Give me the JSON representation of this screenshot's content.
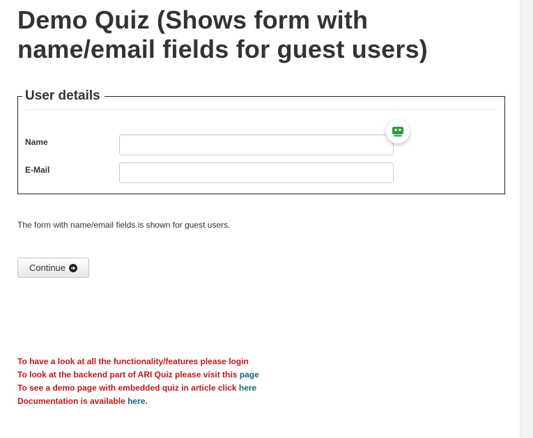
{
  "quiz": {
    "title": "Demo Quiz (Shows form with name/email fields for guest users)"
  },
  "user_details": {
    "legend": "User details",
    "name_label": "Name",
    "name_value": "",
    "email_label": "E-Mail",
    "email_value": ""
  },
  "note": "The form with name/email fields is shown for guest users.",
  "continue_button": {
    "label": "Continue",
    "icon": "arrow-circle-right-icon"
  },
  "info_links": {
    "line1": "To have a look at all the functionality/features please login",
    "line2_text": "To look at the backend part of ARI Quiz please visit this",
    "line2_link": "page",
    "line3_text": "To see a demo page with embedded quiz in article click",
    "line3_link": "here",
    "line4_text": "Documentation is available",
    "line4_link": "here",
    "line4_suffix": "."
  },
  "colors": {
    "info_text": "#c0161a",
    "link": "#16667a",
    "helper_icon": "#2e9e3a"
  },
  "helper_icon": "password-manager-icon"
}
